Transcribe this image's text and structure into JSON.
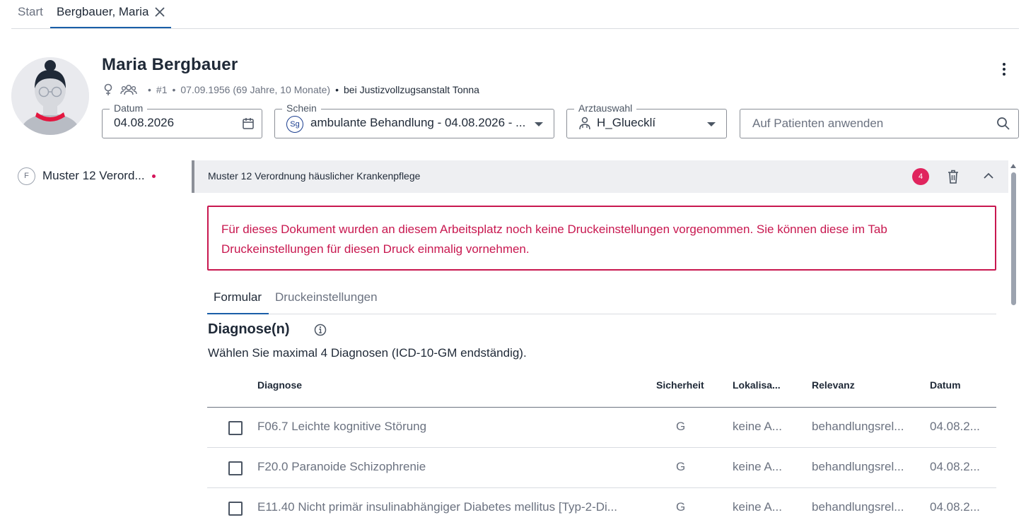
{
  "tabs": {
    "start": "Start",
    "patient": "Bergbauer, Maria"
  },
  "patient": {
    "name": "Maria Bergbauer",
    "number": "#1",
    "birth": "07.09.1956 (69 Jahre, 10 Monate)",
    "institution": "bei Justizvollzugsanstalt Tonna"
  },
  "fields": {
    "datum_label": "Datum",
    "datum_value": "04.08.2026",
    "schein_label": "Schein",
    "schein_badge": "Sg",
    "schein_value": "ambulante Behandlung - 04.08.2026 - ...",
    "arzt_label": "Arztauswahl",
    "arzt_value": "H_Gluecklí",
    "search_placeholder": "Auf Patienten anwenden"
  },
  "left": {
    "item_icon": "F",
    "item_label": "Muster 12 Verord..."
  },
  "section": {
    "title": "Muster 12 Verordnung häuslicher Krankenpflege",
    "badge": "4"
  },
  "warning": {
    "line1": "Für dieses Dokument wurden an diesem Arbeitsplatz noch keine Druckeinstellungen vorgenommen. Sie können diese im Tab",
    "line2": "Druckeinstellungen für diesen Druck einmalig vornehmen."
  },
  "subtabs": {
    "formular": "Formular",
    "druck": "Druckeinstellungen"
  },
  "diagnose": {
    "title": "Diagnose(n)",
    "hint": "Wählen Sie maximal 4 Diagnosen (ICD-10-GM endständig).",
    "headers": [
      "Diagnose",
      "Sicherheit",
      "Lokalisa...",
      "Relevanz",
      "Datum"
    ],
    "rows": [
      [
        "F06.7 Leichte kognitive Störung",
        "G",
        "keine A...",
        "behandlungsrel...",
        "04.08.2..."
      ],
      [
        "F20.0 Paranoide Schizophrenie",
        "G",
        "keine A...",
        "behandlungsrel...",
        "04.08.2..."
      ],
      [
        "E11.40 Nicht primär insulinabhängiger Diabetes mellitus [Typ-2-Di...",
        "G",
        "keine A...",
        "behandlungsrel...",
        "04.08.2..."
      ]
    ]
  },
  "colors": {
    "accent": "#1a5ea8",
    "alert": "#c8174f",
    "badge": "#e0245e"
  }
}
